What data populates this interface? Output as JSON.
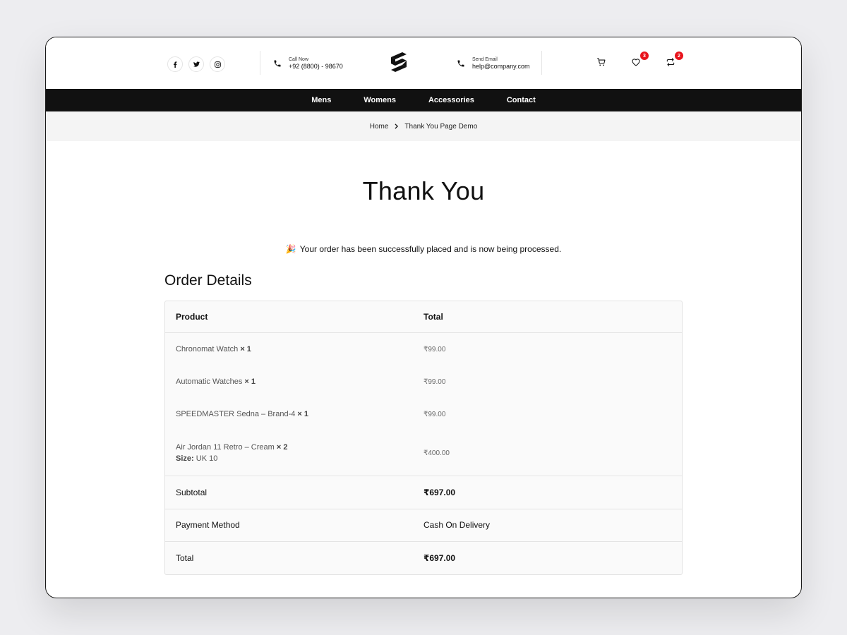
{
  "header": {
    "social": [
      "facebook-icon",
      "twitter-icon",
      "instagram-icon"
    ],
    "call": {
      "label": "Call Now",
      "value": "+92 (8800) - 98670"
    },
    "email": {
      "label": "Send Email",
      "value": "help@company.com"
    },
    "wishlist_count": "3",
    "compare_count": "2",
    "badge_color": "#e8141d"
  },
  "nav": {
    "items": [
      "Mens",
      "Womens",
      "Accessories",
      "Contact"
    ]
  },
  "breadcrumb": {
    "home": "Home",
    "current": "Thank You Page Demo"
  },
  "page": {
    "title": "Thank You",
    "emoji": "🎉",
    "message": "Your order has been successfully placed and is now being processed."
  },
  "order": {
    "section_title": "Order Details",
    "columns": [
      "Product",
      "Total"
    ],
    "items": [
      {
        "name": "Chronomat Watch",
        "qty": "× 1",
        "price": "₹99.00"
      },
      {
        "name": "Automatic Watches",
        "qty": "× 1",
        "price": "₹99.00"
      },
      {
        "name": "SPEEDMASTER Sedna – Brand-4",
        "qty": "× 1",
        "price": "₹99.00"
      },
      {
        "name": "Air Jordan 11 Retro – Cream",
        "qty": "× 2",
        "meta_label": "Size:",
        "meta_value": "UK 10",
        "price": "₹400.00"
      }
    ],
    "subtotal_label": "Subtotal",
    "subtotal": "₹697.00",
    "payment_label": "Payment Method",
    "payment": "Cash On Delivery",
    "total_label": "Total",
    "total": "₹697.00"
  }
}
